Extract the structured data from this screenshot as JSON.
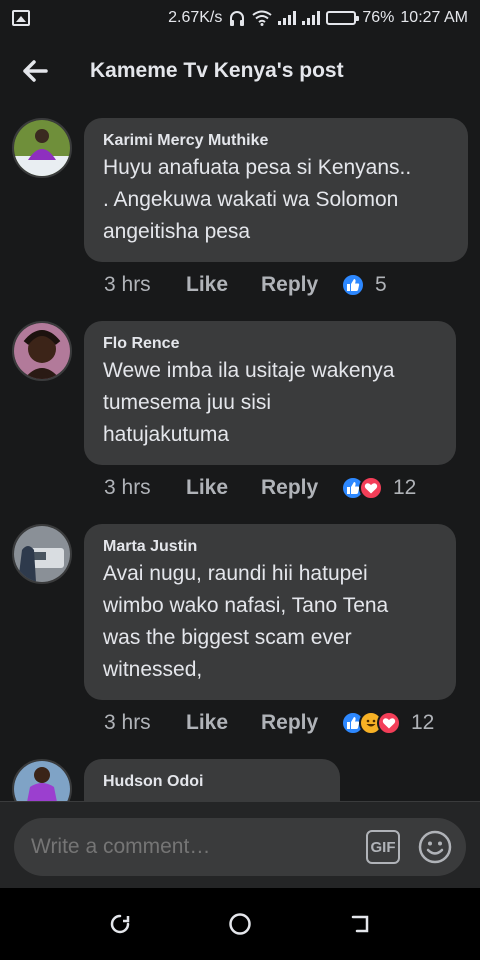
{
  "status_bar": {
    "speed": "2.67K/s",
    "battery": "76%",
    "battery_level": 0.76,
    "time": "10:27 AM"
  },
  "header": {
    "title": "Kameme Tv Kenya's post"
  },
  "comments": [
    {
      "author": "Karimi Mercy Muthike",
      "text": "Huyu anafuata pesa si Kenyans..\n. Angekuwa wakati wa Solomon\nangeitisha pesa",
      "time": "3 hrs",
      "like_label": "Like",
      "reply_label": "Reply",
      "reactions": [
        "like"
      ],
      "reaction_count": "5"
    },
    {
      "author": "Flo Rence",
      "text": "Wewe imba ila usitaje wakenya\ntumesema juu sisi\nhatujakutuma",
      "time": "3 hrs",
      "like_label": "Like",
      "reply_label": "Reply",
      "reactions": [
        "like",
        "love"
      ],
      "reaction_count": "12"
    },
    {
      "author": "Marta Justin",
      "text": "Avai nugu, raundi hii hatupei\nwimbo wako nafasi, Tano Tena\nwas the biggest scam ever\nwitnessed,",
      "time": "3 hrs",
      "like_label": "Like",
      "reply_label": "Reply",
      "reactions": [
        "like",
        "haha",
        "love"
      ],
      "reaction_count": "12"
    },
    {
      "author": "Hudson Odoi",
      "text": "",
      "time": "",
      "like_label": "",
      "reply_label": "",
      "reactions": [],
      "reaction_count": ""
    }
  ],
  "composer": {
    "placeholder": "Write a comment…",
    "gif_label": "GIF"
  },
  "colors": {
    "background": "#18191a",
    "bubble": "#3a3b3c",
    "like_blue": "#2d88ff",
    "love_red": "#f33e58",
    "haha_yellow": "#f7b125"
  }
}
